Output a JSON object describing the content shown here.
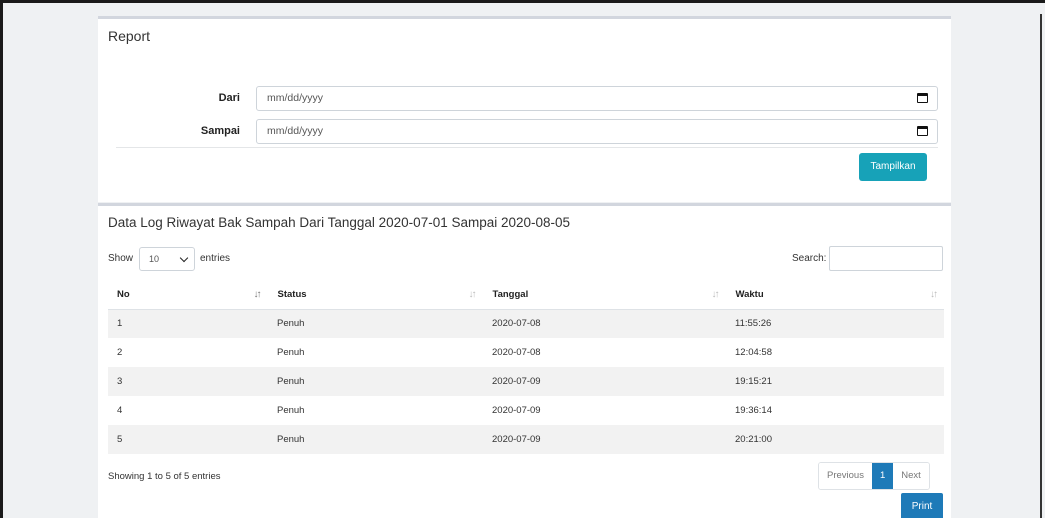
{
  "report": {
    "title": "Report",
    "from_label": "Dari",
    "from_placeholder": "mm/dd/yyyy",
    "to_label": "Sampai",
    "to_placeholder": "mm/dd/yyyy",
    "submit_label": "Tampilkan"
  },
  "log": {
    "title": "Data Log Riwayat Bak Sampah Dari Tanggal 2020-07-01 Sampai 2020-08-05",
    "show_label": "Show",
    "entries_value": "10",
    "entries_label": "entries",
    "search_label": "Search:",
    "columns": [
      "No",
      "Status",
      "Tanggal",
      "Waktu"
    ],
    "rows": [
      {
        "no": "1",
        "status": "Penuh",
        "tanggal": "2020-07-08",
        "waktu": "11:55:26"
      },
      {
        "no": "2",
        "status": "Penuh",
        "tanggal": "2020-07-08",
        "waktu": "12:04:58"
      },
      {
        "no": "3",
        "status": "Penuh",
        "tanggal": "2020-07-09",
        "waktu": "19:15:21"
      },
      {
        "no": "4",
        "status": "Penuh",
        "tanggal": "2020-07-09",
        "waktu": "19:36:14"
      },
      {
        "no": "5",
        "status": "Penuh",
        "tanggal": "2020-07-09",
        "waktu": "20:21:00"
      }
    ],
    "info": "Showing 1 to 5 of 5 entries",
    "pagination": {
      "previous": "Previous",
      "current": "1",
      "next": "Next"
    },
    "print_label": "Print"
  },
  "icons": {
    "calendar": "calendar-icon",
    "sort": "sort-icon",
    "chevron": "chevron-down-icon"
  },
  "colors": {
    "accent_info": "#17a2b8",
    "accent_primary": "#1e7ab8"
  }
}
